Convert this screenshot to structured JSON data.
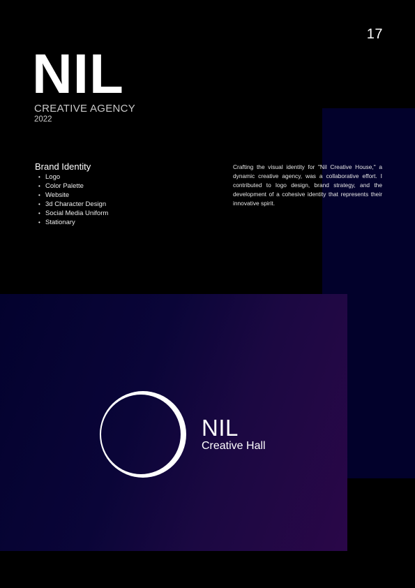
{
  "header": {
    "page_number": "17",
    "title": "NIL",
    "subtitle": "CREATIVE AGENCY",
    "year": "2022"
  },
  "section": {
    "heading": "Brand Identity",
    "items": [
      {
        "label": "Logo"
      },
      {
        "label": "Color Palette"
      },
      {
        "label": "Website"
      },
      {
        "label": "3d Character Design"
      },
      {
        "label": "Social Media Uniform"
      },
      {
        "label": "Stationary"
      }
    ]
  },
  "description": "Crafting the visual identity for \"Nil Creative House,\" a dynamic creative agency, was a collaborative effort. I contributed to logo design, brand strategy, and the development of a cohesive identity that represents their innovative spirit.",
  "showcase": {
    "logo_name": "NIL",
    "logo_tagline": "Creative Hall"
  },
  "colors": {
    "background": "#000000",
    "navy_panel": "#02012b",
    "gradient_start": "#03022e",
    "gradient_end": "#2a0748",
    "text": "#ffffff"
  },
  "icons": {
    "logo_mark": "crescent-ring-icon"
  }
}
